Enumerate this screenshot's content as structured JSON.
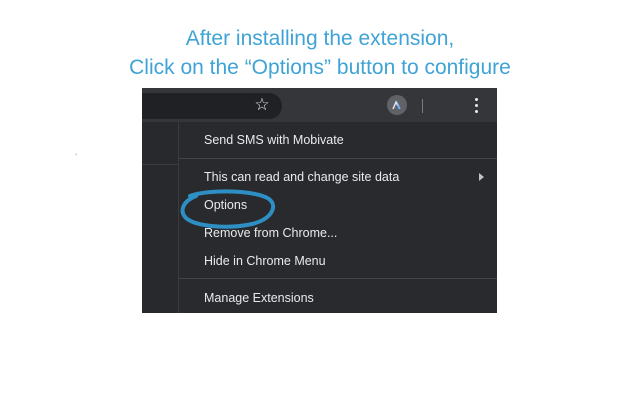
{
  "instructions": {
    "line1": "After installing the extension,",
    "line2": "Click on the “Options” button to configure"
  },
  "stray_mark": "ʼ",
  "toolbar": {
    "star_icon": "star-icon",
    "star_glyph": "☆",
    "extension_icon": "mobivate-extension-icon",
    "menu_icon": "kebab-menu-icon"
  },
  "context_menu": {
    "items": [
      {
        "label": "Send SMS with Mobivate"
      },
      {
        "label": "This can read and change site data",
        "has_submenu": true
      },
      {
        "label": "Options",
        "highlighted": true
      },
      {
        "label": "Remove from Chrome..."
      },
      {
        "label": "Hide in Chrome Menu"
      },
      {
        "label": "Manage Extensions"
      }
    ]
  },
  "colors": {
    "instruction_text": "#3fa3d6",
    "annotation_circle": "#2e8fc4",
    "menu_background": "#292a2d",
    "toolbar_background": "#35363a"
  }
}
